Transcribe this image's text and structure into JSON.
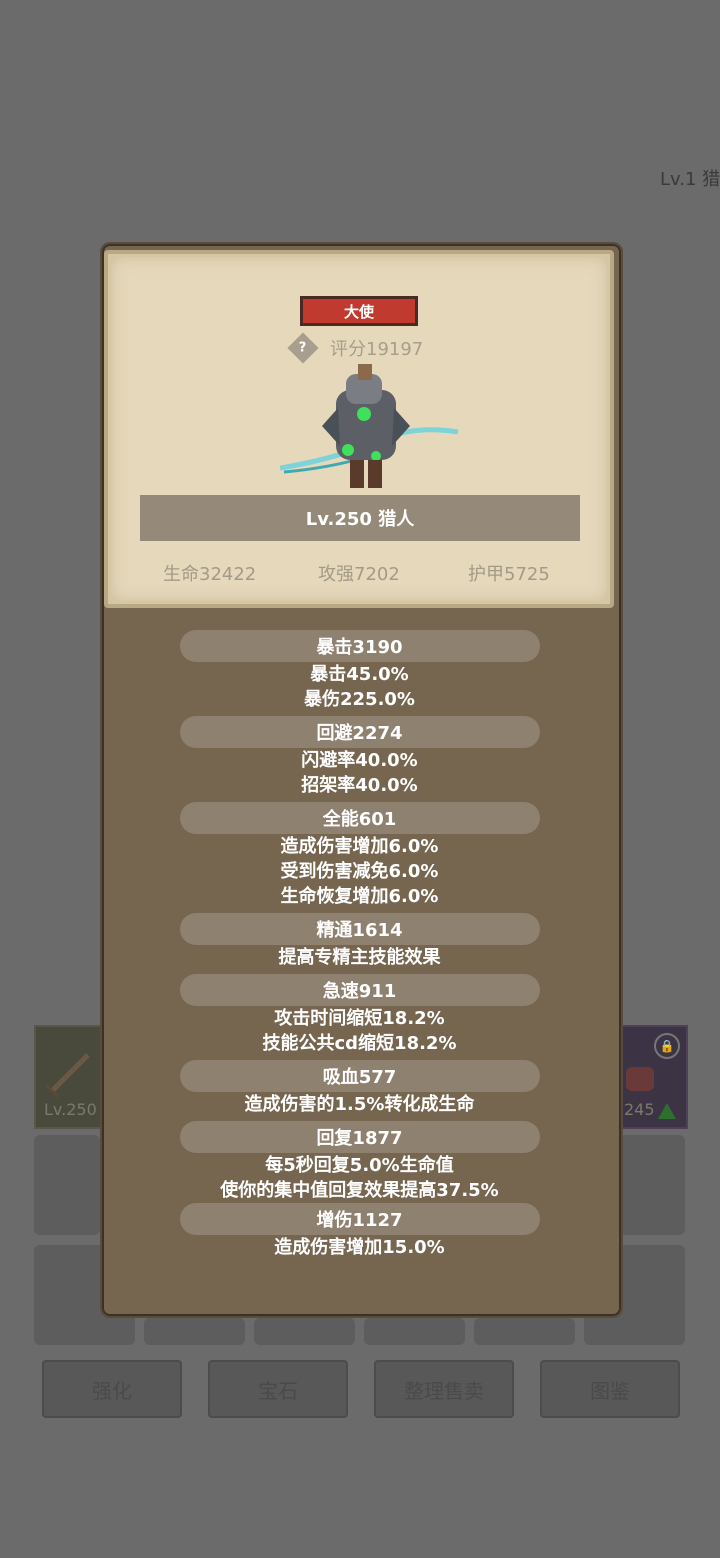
{
  "background": {
    "top_right_label": "Lv.1 猎",
    "left_item_level": "Lv.250",
    "right_item_level": "245",
    "bottom_buttons": [
      "强化",
      "宝石",
      "整理售卖",
      "图鉴"
    ]
  },
  "hero": {
    "rank": "大使",
    "score": "评分19197",
    "name": "Lv.250 猎人",
    "stats": {
      "hp": "生命32422",
      "attack": "攻强7202",
      "armor": "护甲5725"
    }
  },
  "attributes": [
    {
      "title": "暴击3190",
      "details": [
        "暴击45.0%",
        "暴伤225.0%"
      ]
    },
    {
      "title": "回避2274",
      "details": [
        "闪避率40.0%",
        "招架率40.0%"
      ]
    },
    {
      "title": "全能601",
      "details": [
        "造成伤害增加6.0%",
        "受到伤害减免6.0%",
        "生命恢复增加6.0%"
      ]
    },
    {
      "title": "精通1614",
      "details": [
        "提高专精主技能效果"
      ]
    },
    {
      "title": "急速911",
      "details": [
        "攻击时间缩短18.2%",
        "技能公共cd缩短18.2%"
      ]
    },
    {
      "title": "吸血577",
      "details": [
        "造成伤害的1.5%转化成生命"
      ]
    },
    {
      "title": "回复1877",
      "details": [
        "每5秒回复5.0%生命值",
        "使你的集中值回复效果提高37.5%"
      ]
    },
    {
      "title": "增伤1127",
      "details": [
        "造成伤害增加15.0%"
      ]
    }
  ],
  "colors": {
    "rank_badge": "#c03a30",
    "panel": "#766650",
    "parchment": "#e5d8bb"
  }
}
